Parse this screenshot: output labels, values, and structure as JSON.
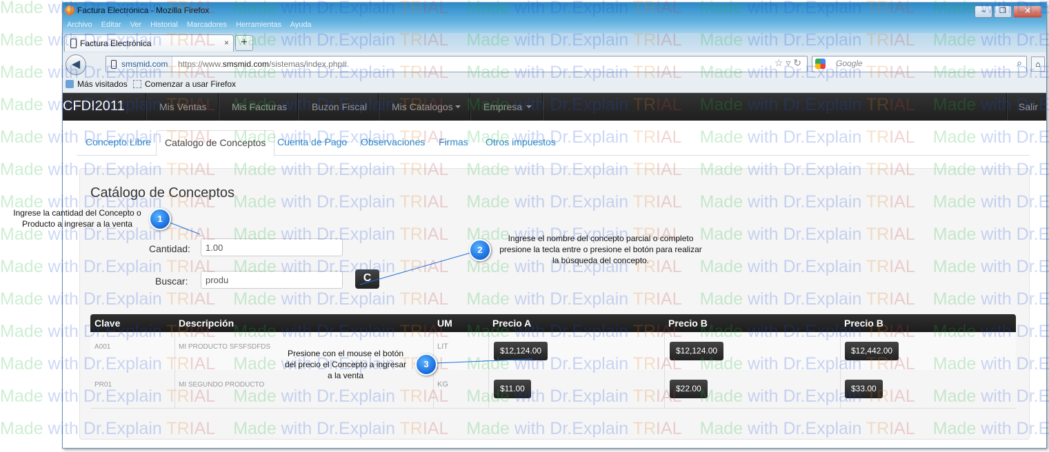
{
  "browser": {
    "window_title": "Factura Electrónica - Mozilla Firefox",
    "menu": [
      "Archivo",
      "Editar",
      "Ver",
      "Historial",
      "Marcadores",
      "Herramientas",
      "Ayuda"
    ],
    "tab_label": "Factura Electrónica",
    "tab_close": "×",
    "new_tab": "+",
    "site_identity": "smsmid.com",
    "url_prefix": "https://www.",
    "url_domain": "smsmid.com",
    "url_path": "/sistemas/index.php#",
    "search_placeholder": "Google",
    "bookmarks": [
      "Más visitados",
      "Comenzar a usar Firefox"
    ]
  },
  "app": {
    "brand": "CFDI2011",
    "nav": [
      "Mis Ventas",
      "Mis Facturas",
      "Buzon Fiscal",
      "Mis Catalogos",
      "Empresa"
    ],
    "logout": "Salir"
  },
  "tabs": [
    "Concepto Libre",
    "Catalogo de Conceptos",
    "Cuenta de Pago",
    "Observaciones",
    "Firmas",
    "Otros impuestos"
  ],
  "catalog": {
    "title": "Catálogo de Conceptos",
    "cantidad_label": "Cantidad:",
    "cantidad_value": "1.00",
    "buscar_label": "Buscar:",
    "buscar_value": "produ",
    "refresh_symbol": "C"
  },
  "table": {
    "headers": [
      "Clave",
      "Descripción",
      "UM",
      "Precio A",
      "Precio B",
      "Precio B"
    ],
    "rows": [
      {
        "clave": "A001",
        "descripcion": "MI PRODUCTO SFSFSDFDS",
        "um": "LIT",
        "precio_a": "$12,124.00",
        "precio_b": "$12,124.00",
        "precio_c": "$12,442.00"
      },
      {
        "clave": "PR01",
        "descripcion": "MI SEGUNDO PRODUCTO",
        "um": "KG",
        "precio_a": "$11.00",
        "precio_b": "$22.00",
        "precio_c": "$33.00"
      }
    ]
  },
  "callouts": [
    {
      "number": "1",
      "lines": [
        "Ingrese la cantidad del Concepto o",
        "Producto a ingresar a la venta"
      ]
    },
    {
      "number": "2",
      "lines": [
        "Ingrese el nombre del concepto parcial o completo",
        "presione la tecla entre o presione el botón para realizar",
        "la búsqueda del concepto."
      ]
    },
    {
      "number": "3",
      "lines": [
        "Presione con el mouse el botón",
        "del precio el Concepto a ingresar",
        "a la venta"
      ]
    }
  ],
  "watermark": {
    "made": "Made",
    "with": "with Dr.Explain",
    "tr": "TR",
    "ial": "IAL"
  },
  "colors": {
    "navbar": "#222222",
    "link": "#2a86c7",
    "callout_blue": "#1b6fe0"
  }
}
